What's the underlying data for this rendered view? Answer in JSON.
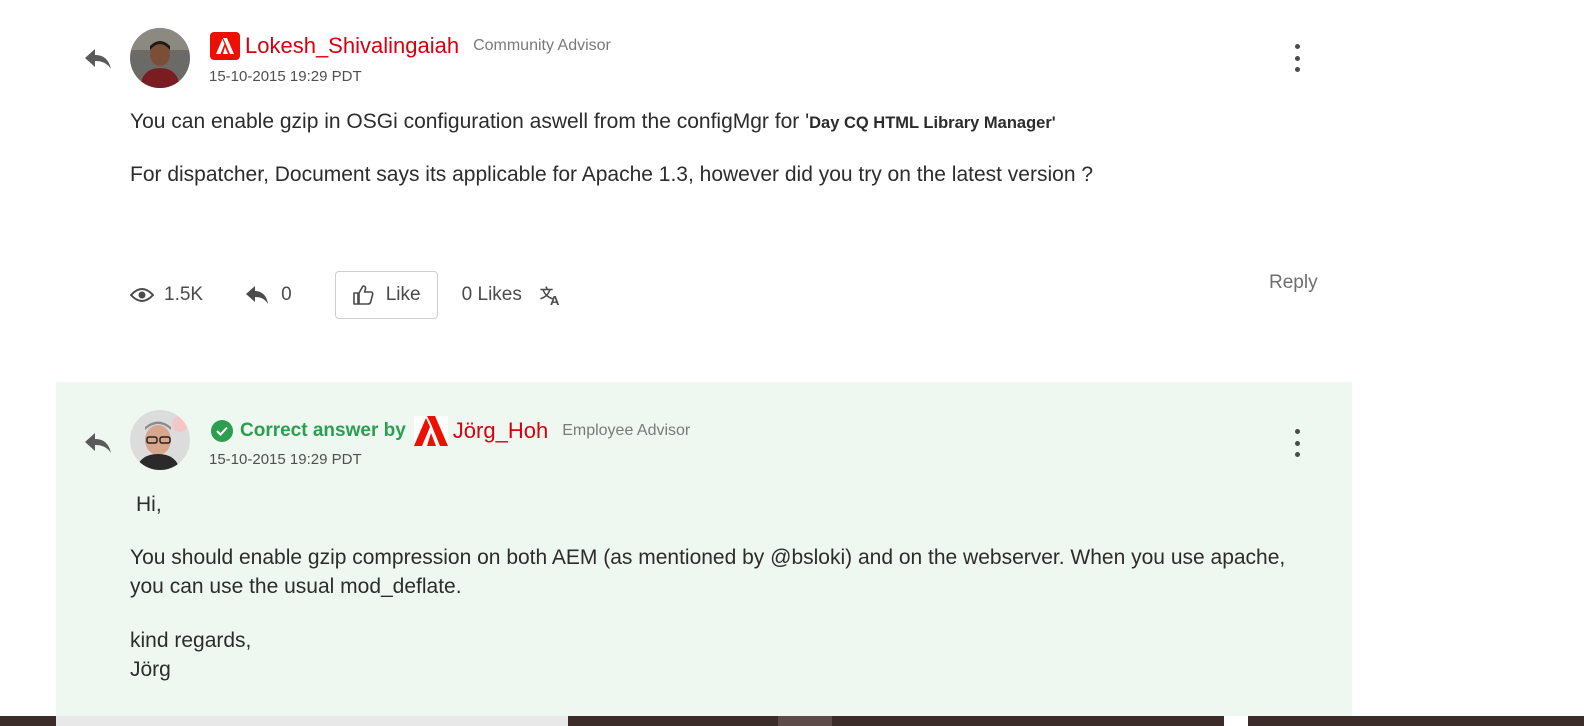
{
  "post1": {
    "author": "Lokesh_Shivalingaiah",
    "role": "Community Advisor",
    "timestamp": "15-10-2015 19:29 PDT",
    "body_line1": "You can enable gzip in OSGi configuration aswell from the configMgr for '",
    "body_line1_strong": "Day CQ HTML Library Manager'",
    "body_line2": "For dispatcher, Document says its applicable for Apache 1.3, however did you try on the latest version ?",
    "views": "1.5K",
    "replies": "0",
    "like_label": "Like",
    "likes": "0 Likes",
    "reply_label": "Reply"
  },
  "post2": {
    "correct_label": "Correct answer by",
    "author": "Jörg_Hoh",
    "role": "Employee Advisor",
    "timestamp": "15-10-2015 19:29 PDT",
    "greeting": "Hi,",
    "body_line1": "You should enable gzip compression on both AEM (as mentioned by @bsloki) and on the webserver. When you use apache,",
    "body_line2": "you can use the usual mod_deflate.",
    "sign1": "kind regards,",
    "sign2": "Jörg"
  },
  "icons": {
    "reply": "reply-arrow-icon",
    "more": "more-vertical-icon",
    "views": "eye-icon",
    "replies": "reply-icon",
    "like": "thumbs-up-icon",
    "translate": "translate-icon",
    "verified": "check-circle-icon",
    "brand": "adobe-logo-icon"
  },
  "colors": {
    "author": "#d7000f",
    "correct": "#2d9d4f",
    "answer_bg": "#eef8f0"
  }
}
